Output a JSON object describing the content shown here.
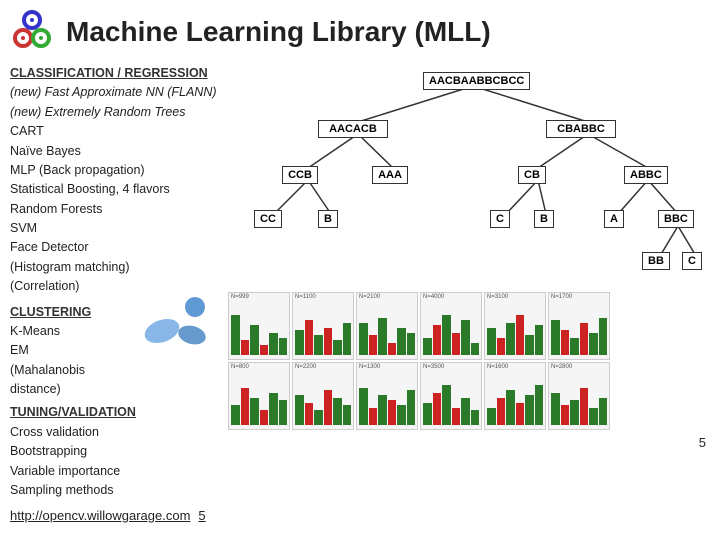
{
  "header": {
    "title": "Machine Learning Library (MLL)"
  },
  "left": {
    "classification_header": "CLASSIFICATION / REGRESSION",
    "items": [
      {
        "label": "(new) Fast Approximate NN (FLANN)",
        "italic": true
      },
      {
        "label": "(new) Extremely Random Trees",
        "italic": true
      },
      {
        "label": "CART",
        "italic": false
      },
      {
        "label": "Naïve Bayes",
        "italic": false
      },
      {
        "label": "MLP (Back propagation)",
        "italic": false
      },
      {
        "label": "Statistical Boosting, 4 flavors",
        "italic": false
      },
      {
        "label": "Random Forests",
        "italic": false
      },
      {
        "label": "SVM",
        "italic": false
      },
      {
        "label": "Face Detector",
        "italic": false
      },
      {
        "label": "(Histogram matching)",
        "italic": false
      },
      {
        "label": "(Correlation)",
        "italic": false
      }
    ],
    "clustering_header": "CLUSTERING",
    "clustering_items": [
      "K-Means",
      "EM",
      "(Mahalanobis distance)"
    ],
    "tuning_header": "TUNING/VALIDATION",
    "tuning_items": [
      "Cross validation",
      "Bootstrapping",
      "Variable importance",
      "Sampling methods"
    ],
    "url": "http://opencv.willowgarage.com",
    "page_number": "5"
  },
  "tree": {
    "nodes": [
      {
        "id": "root",
        "label": "AACBAABBCBCC"
      },
      {
        "id": "left1",
        "label": "AACACB"
      },
      {
        "id": "right1",
        "label": "CBABBC"
      },
      {
        "id": "ll",
        "label": "CCB"
      },
      {
        "id": "lm",
        "label": "AAA"
      },
      {
        "id": "rl",
        "label": "CB"
      },
      {
        "id": "rr",
        "label": "ABBC"
      },
      {
        "id": "lll",
        "label": "CC"
      },
      {
        "id": "llr",
        "label": "B"
      },
      {
        "id": "rll",
        "label": "C"
      },
      {
        "id": "rlr",
        "label": "B"
      },
      {
        "id": "rrl",
        "label": "A"
      },
      {
        "id": "rrr",
        "label": "BBC"
      },
      {
        "id": "rrrl",
        "label": "BB"
      },
      {
        "id": "rrrr",
        "label": "C"
      }
    ]
  },
  "page_number_right": "5"
}
